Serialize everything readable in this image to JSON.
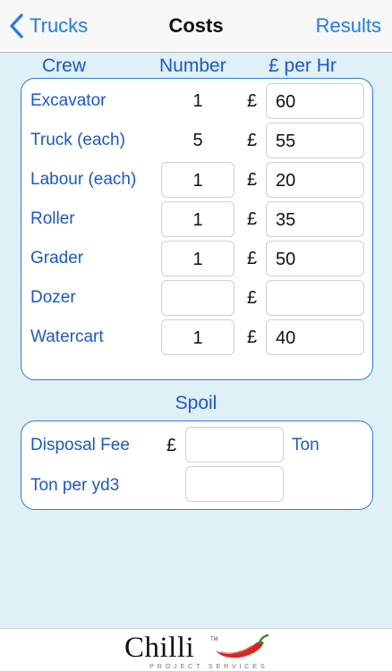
{
  "nav": {
    "back_label": "Trucks",
    "title": "Costs",
    "right_label": "Results"
  },
  "headers": {
    "crew": "Crew",
    "number": "Number",
    "rate": "£ per Hr"
  },
  "currency_symbol": "£",
  "crew": [
    {
      "label": "Excavator",
      "number": "1",
      "number_editable": false,
      "rate": "60"
    },
    {
      "label": "Truck (each)",
      "number": "5",
      "number_editable": false,
      "rate": "55"
    },
    {
      "label": "Labour (each)",
      "number": "1",
      "number_editable": true,
      "rate": "20"
    },
    {
      "label": "Roller",
      "number": "1",
      "number_editable": true,
      "rate": "35"
    },
    {
      "label": "Grader",
      "number": "1",
      "number_editable": true,
      "rate": "50"
    },
    {
      "label": "Dozer",
      "number": "",
      "number_editable": true,
      "rate": ""
    },
    {
      "label": "Watercart",
      "number": "1",
      "number_editable": true,
      "rate": "40"
    }
  ],
  "spoil": {
    "title": "Spoil",
    "disposal_fee_label": "Disposal Fee",
    "disposal_fee_value": "",
    "disposal_fee_unit": "Ton",
    "ton_per_yd3_label": "Ton per yd3",
    "ton_per_yd3_value": ""
  },
  "footer": {
    "logo_text": "Chilli",
    "logo_tm": "TM",
    "logo_subtitle": "PROJECT SERVICES"
  },
  "colors": {
    "accent_blue": "#1b7cf6",
    "label_blue": "#1b56d8",
    "background": "#dff0f6",
    "panel_border": "#2f7de0",
    "pepper_red": "#d6281f",
    "pepper_green": "#3f8a2a"
  }
}
